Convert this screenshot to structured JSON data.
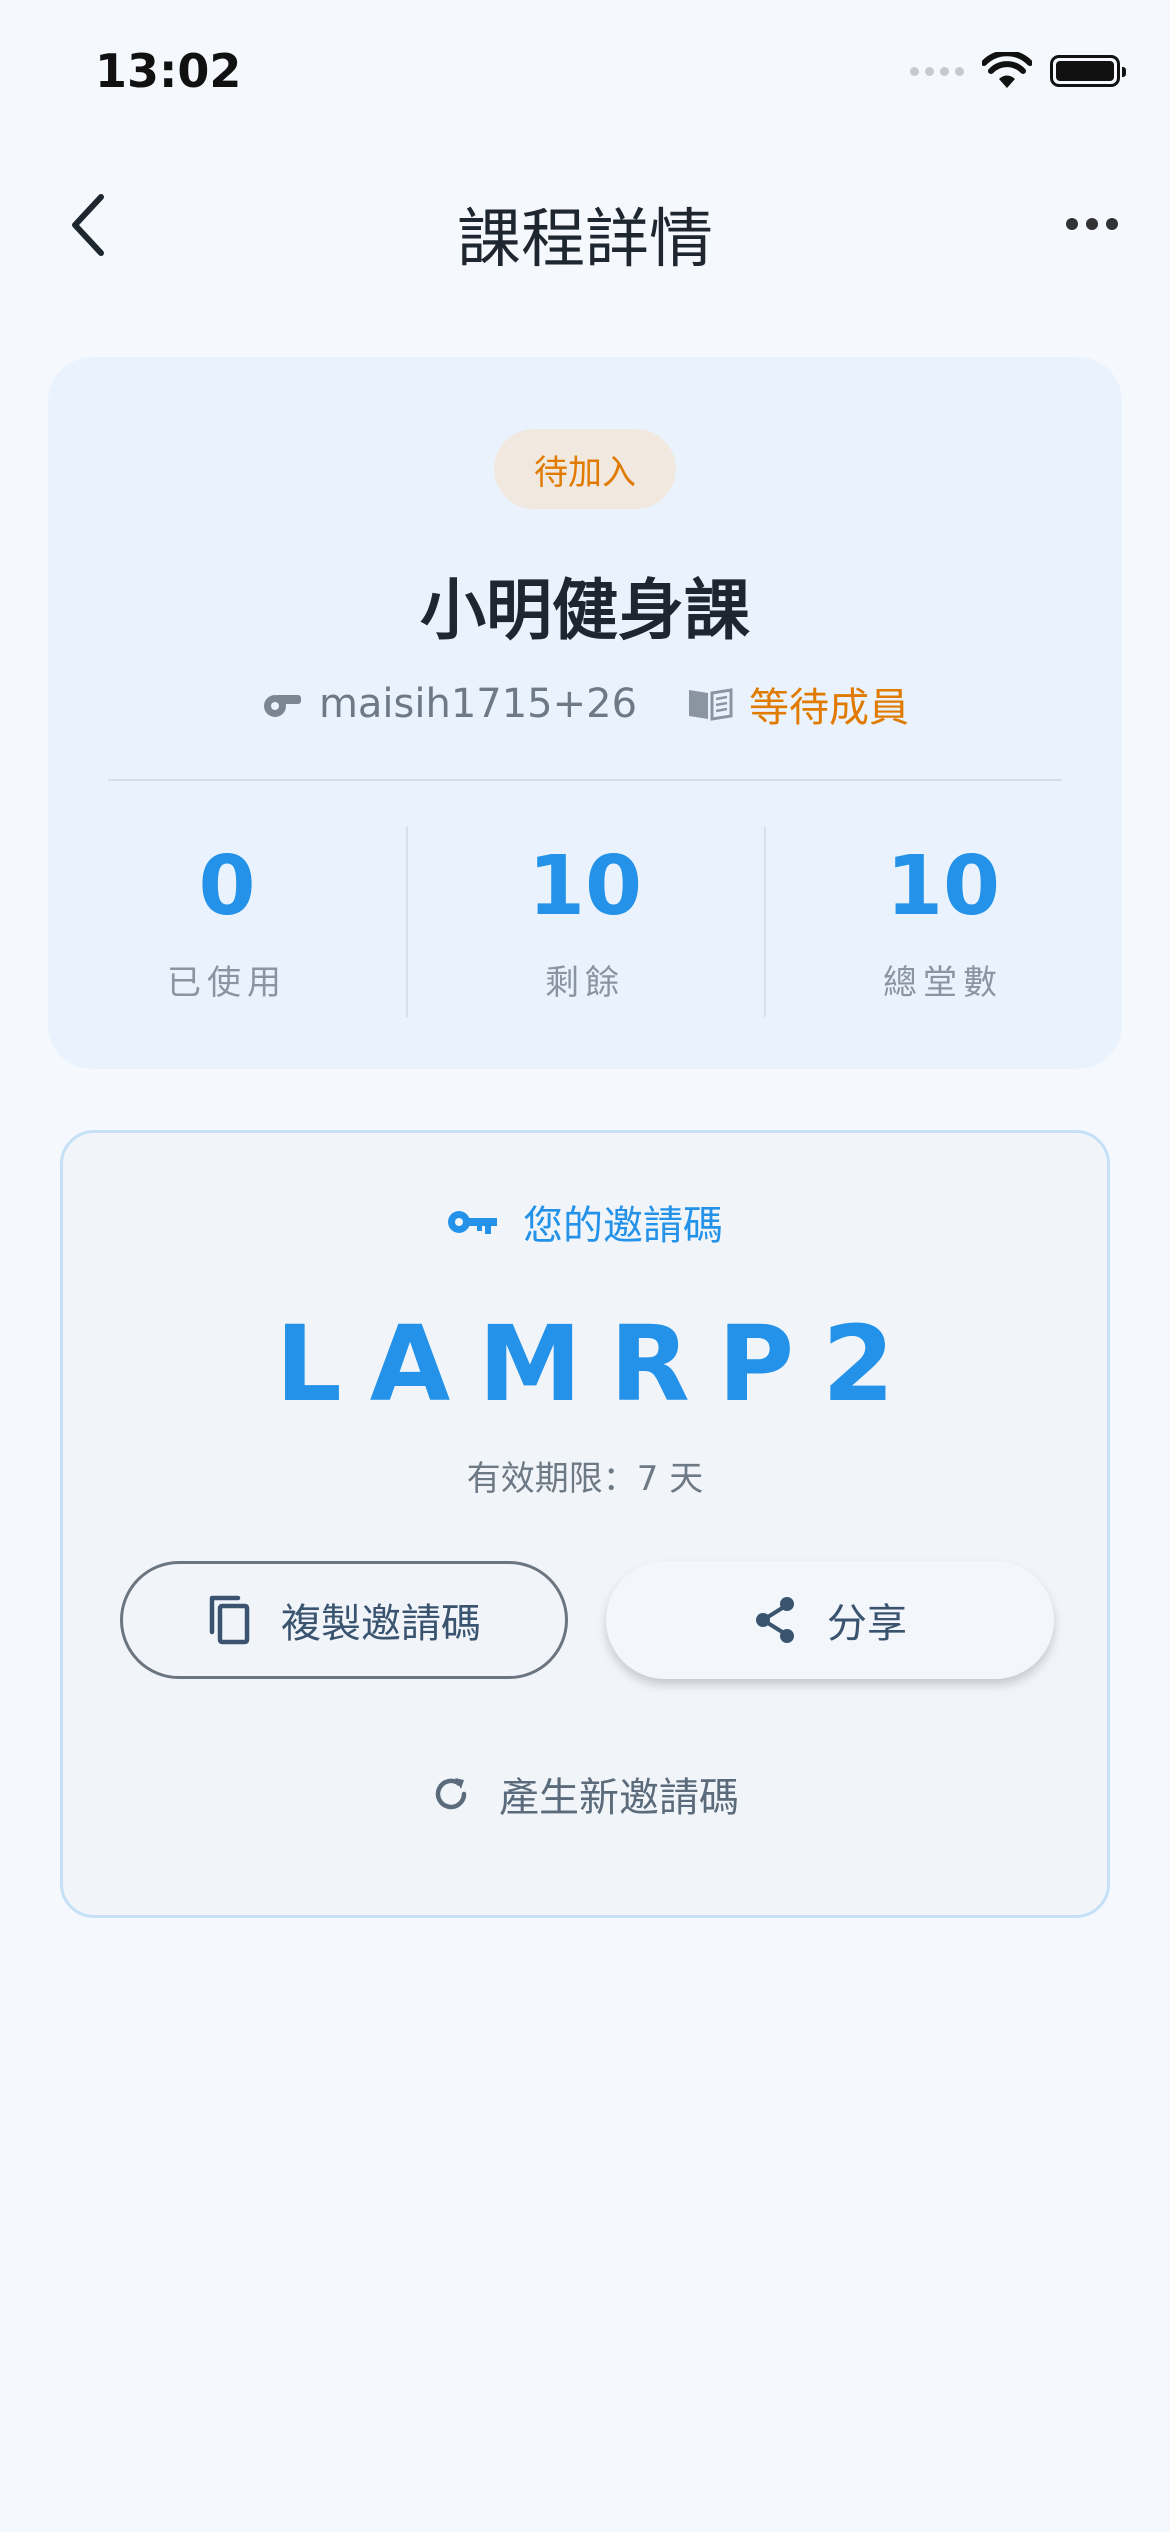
{
  "status_bar": {
    "time": "13:02"
  },
  "nav": {
    "title": "課程詳情"
  },
  "course": {
    "badge": "待加入",
    "name": "小明健身課",
    "owner": "maisih1715+26",
    "member_status": "等待成員",
    "stats": [
      {
        "value": "0",
        "label": "已使用"
      },
      {
        "value": "10",
        "label": "剩餘"
      },
      {
        "value": "10",
        "label": "總堂數"
      }
    ]
  },
  "invite": {
    "header": "您的邀請碼",
    "code": "LAMRP2",
    "expiry": "有效期限：7 天",
    "copy_label": "複製邀請碼",
    "share_label": "分享",
    "regenerate_label": "產生新邀請碼"
  },
  "colors": {
    "accent": "#2492e8",
    "pending": "#e07b00",
    "background": "#f5f8fd",
    "card": "#eaf3fd"
  }
}
